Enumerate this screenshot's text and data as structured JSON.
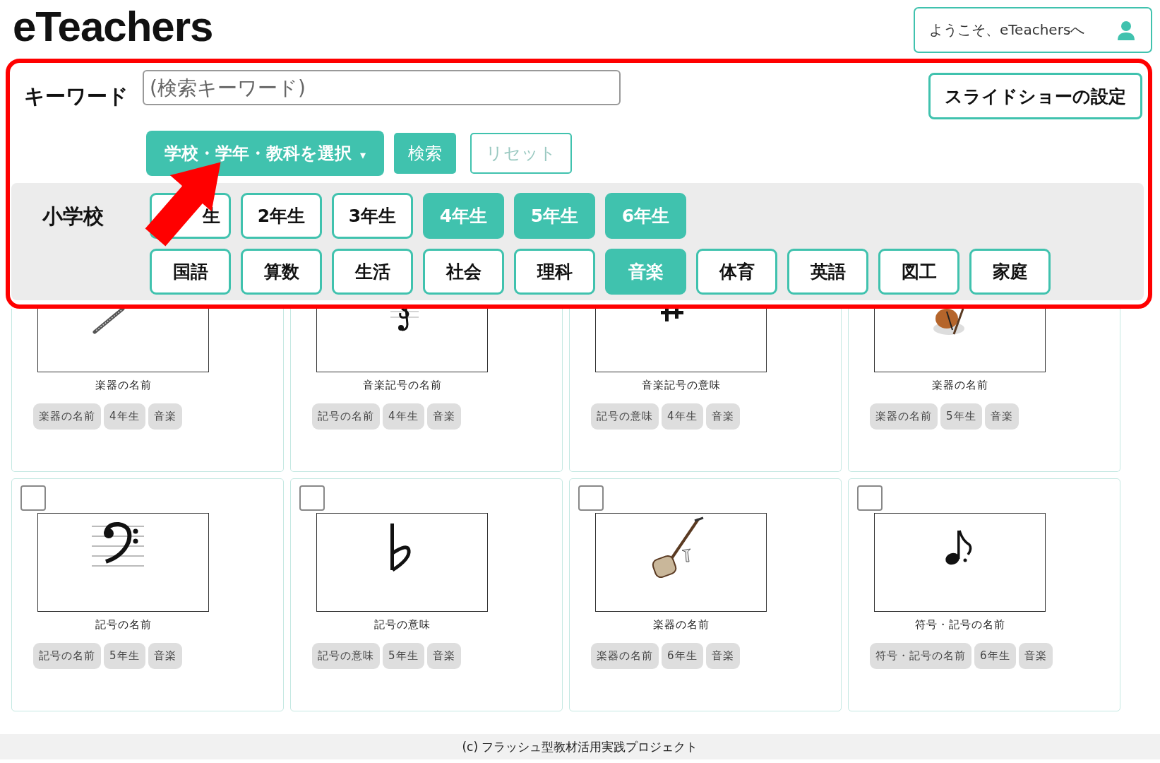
{
  "logo": "eTeachers",
  "welcome": "ようこそ、eTeachersへ",
  "search": {
    "label": "キーワード",
    "placeholder": "(検索キーワード)"
  },
  "slideshow_button": "スライドショーの設定",
  "select_button": {
    "label": "学校・学年・教科を選択",
    "caret": "▾"
  },
  "search_button": "検索",
  "reset_button": "リセット",
  "school": "小学校",
  "grades": [
    {
      "label": "生",
      "selected": false
    },
    {
      "label": "2年生",
      "selected": false
    },
    {
      "label": "3年生",
      "selected": false
    },
    {
      "label": "4年生",
      "selected": true
    },
    {
      "label": "5年生",
      "selected": true
    },
    {
      "label": "6年生",
      "selected": true
    }
  ],
  "subjects": [
    {
      "label": "国語",
      "selected": false
    },
    {
      "label": "算数",
      "selected": false
    },
    {
      "label": "生活",
      "selected": false
    },
    {
      "label": "社会",
      "selected": false
    },
    {
      "label": "理科",
      "selected": false
    },
    {
      "label": "音楽",
      "selected": true
    },
    {
      "label": "体育",
      "selected": false
    },
    {
      "label": "英語",
      "selected": false
    },
    {
      "label": "図工",
      "selected": false
    },
    {
      "label": "家庭",
      "selected": false
    }
  ],
  "cards": [
    {
      "title": "楽器の名前",
      "tags": [
        "楽器の名前",
        "4年生",
        "音楽"
      ]
    },
    {
      "title": "音楽記号の名前",
      "tags": [
        "記号の名前",
        "4年生",
        "音楽"
      ]
    },
    {
      "title": "音楽記号の意味",
      "tags": [
        "記号の意味",
        "4年生",
        "音楽"
      ]
    },
    {
      "title": "楽器の名前",
      "tags": [
        "楽器の名前",
        "5年生",
        "音楽"
      ]
    },
    {
      "title": "記号の名前",
      "checked": false,
      "tags": [
        "記号の名前",
        "5年生",
        "音楽"
      ]
    },
    {
      "title": "記号の意味",
      "checked": false,
      "tags": [
        "記号の意味",
        "5年生",
        "音楽"
      ]
    },
    {
      "title": "楽器の名前",
      "checked": false,
      "tags": [
        "楽器の名前",
        "6年生",
        "音楽"
      ]
    },
    {
      "title": "符号・記号の名前",
      "checked": false,
      "tags": [
        "符号・記号の名前",
        "6年生",
        "音楽"
      ]
    }
  ],
  "footer": "(c) フラッシュ型教材活用実践プロジェクト"
}
